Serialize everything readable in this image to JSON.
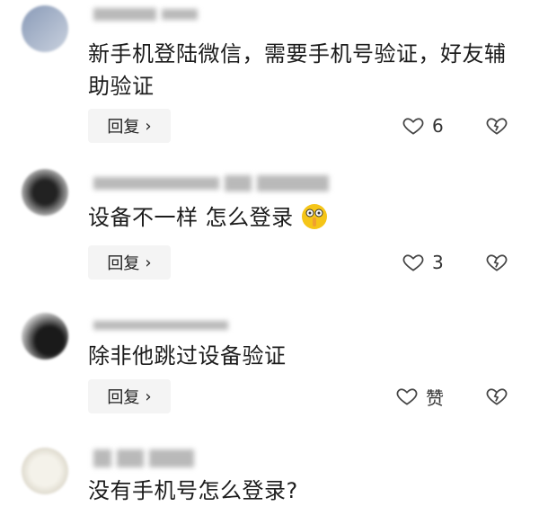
{
  "comments": [
    {
      "text": "新手机登陆微信，需要手机号验证，好友辅助验证",
      "reply_label": "回复",
      "like_label": "6"
    },
    {
      "text": "设备不一样 怎么登录",
      "reply_label": "回复",
      "like_label": "3"
    },
    {
      "text": "除非他跳过设备验证",
      "reply_label": "回复",
      "like_label": "赞"
    },
    {
      "text": "没有手机号怎么登录?"
    }
  ],
  "icons": {
    "like": "heart-outline-icon",
    "dislike": "broken-heart-icon",
    "reply_arrow": "chevron-right-icon",
    "emoji": "shush-emoji-icon"
  }
}
